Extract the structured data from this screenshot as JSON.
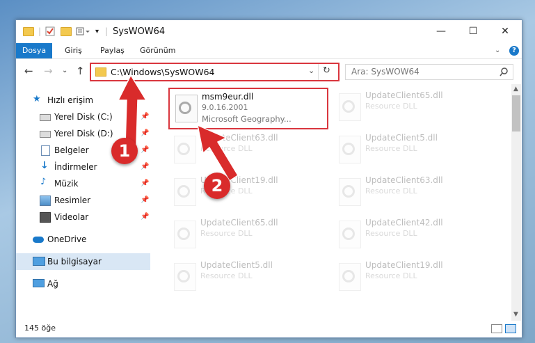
{
  "window": {
    "title": "SysWOW64",
    "minimize_glyph": "—",
    "maximize_glyph": "☐",
    "close_glyph": "✕"
  },
  "ribbon": {
    "tabs": [
      "Dosya",
      "Giriş",
      "Paylaş",
      "Görünüm"
    ]
  },
  "address": {
    "path": "C:\\Windows\\SysWOW64",
    "search_placeholder": "Ara: SysWOW64"
  },
  "sidebar": {
    "items": [
      {
        "label": "Hızlı erişim",
        "icon": "star-icon"
      },
      {
        "label": "Yerel Disk (C:)",
        "icon": "drive-icon",
        "pinned": true
      },
      {
        "label": "Yerel Disk (D:)",
        "icon": "drive-icon",
        "pinned": true
      },
      {
        "label": "Belgeler",
        "icon": "documents-icon",
        "pinned": true
      },
      {
        "label": "İndirmeler",
        "icon": "download-icon",
        "pinned": true
      },
      {
        "label": "Müzik",
        "icon": "music-icon",
        "pinned": true
      },
      {
        "label": "Resimler",
        "icon": "pictures-icon",
        "pinned": true
      },
      {
        "label": "Videolar",
        "icon": "videos-icon",
        "pinned": true
      },
      {
        "label": "OneDrive",
        "icon": "cloud-icon"
      },
      {
        "label": "Bu bilgisayar",
        "icon": "computer-icon",
        "selected": true
      },
      {
        "label": "Ağ",
        "icon": "network-icon"
      }
    ]
  },
  "files": [
    {
      "name": "msm9eur.dll",
      "version": "9.0.16.2001",
      "desc": "Microsoft Geography..."
    },
    {
      "name": "UpdateClient65.dll",
      "desc": "Resource DLL"
    },
    {
      "name": "UpdateClient63.dll",
      "desc": "Resource DLL"
    },
    {
      "name": "UpdateClient5.dll",
      "desc": "Resource DLL"
    },
    {
      "name": "UpdateClient19.dll",
      "desc": "Resource DLL"
    },
    {
      "name": "UpdateClient63.dll",
      "desc": "Resource DLL"
    },
    {
      "name": "UpdateClient65.dll",
      "desc": "Resource DLL"
    },
    {
      "name": "UpdateClient42.dll",
      "desc": "Resource DLL"
    },
    {
      "name": "UpdateClient5.dll",
      "desc": "Resource DLL"
    },
    {
      "name": "UpdateClient19.dll",
      "desc": "Resource DLL"
    }
  ],
  "status": {
    "count": "145 öğe"
  },
  "annotations": {
    "badge1": "1",
    "badge2": "2"
  },
  "colors": {
    "accent": "#1979ca",
    "highlight": "#d9363e",
    "badge": "#d92b2b"
  }
}
